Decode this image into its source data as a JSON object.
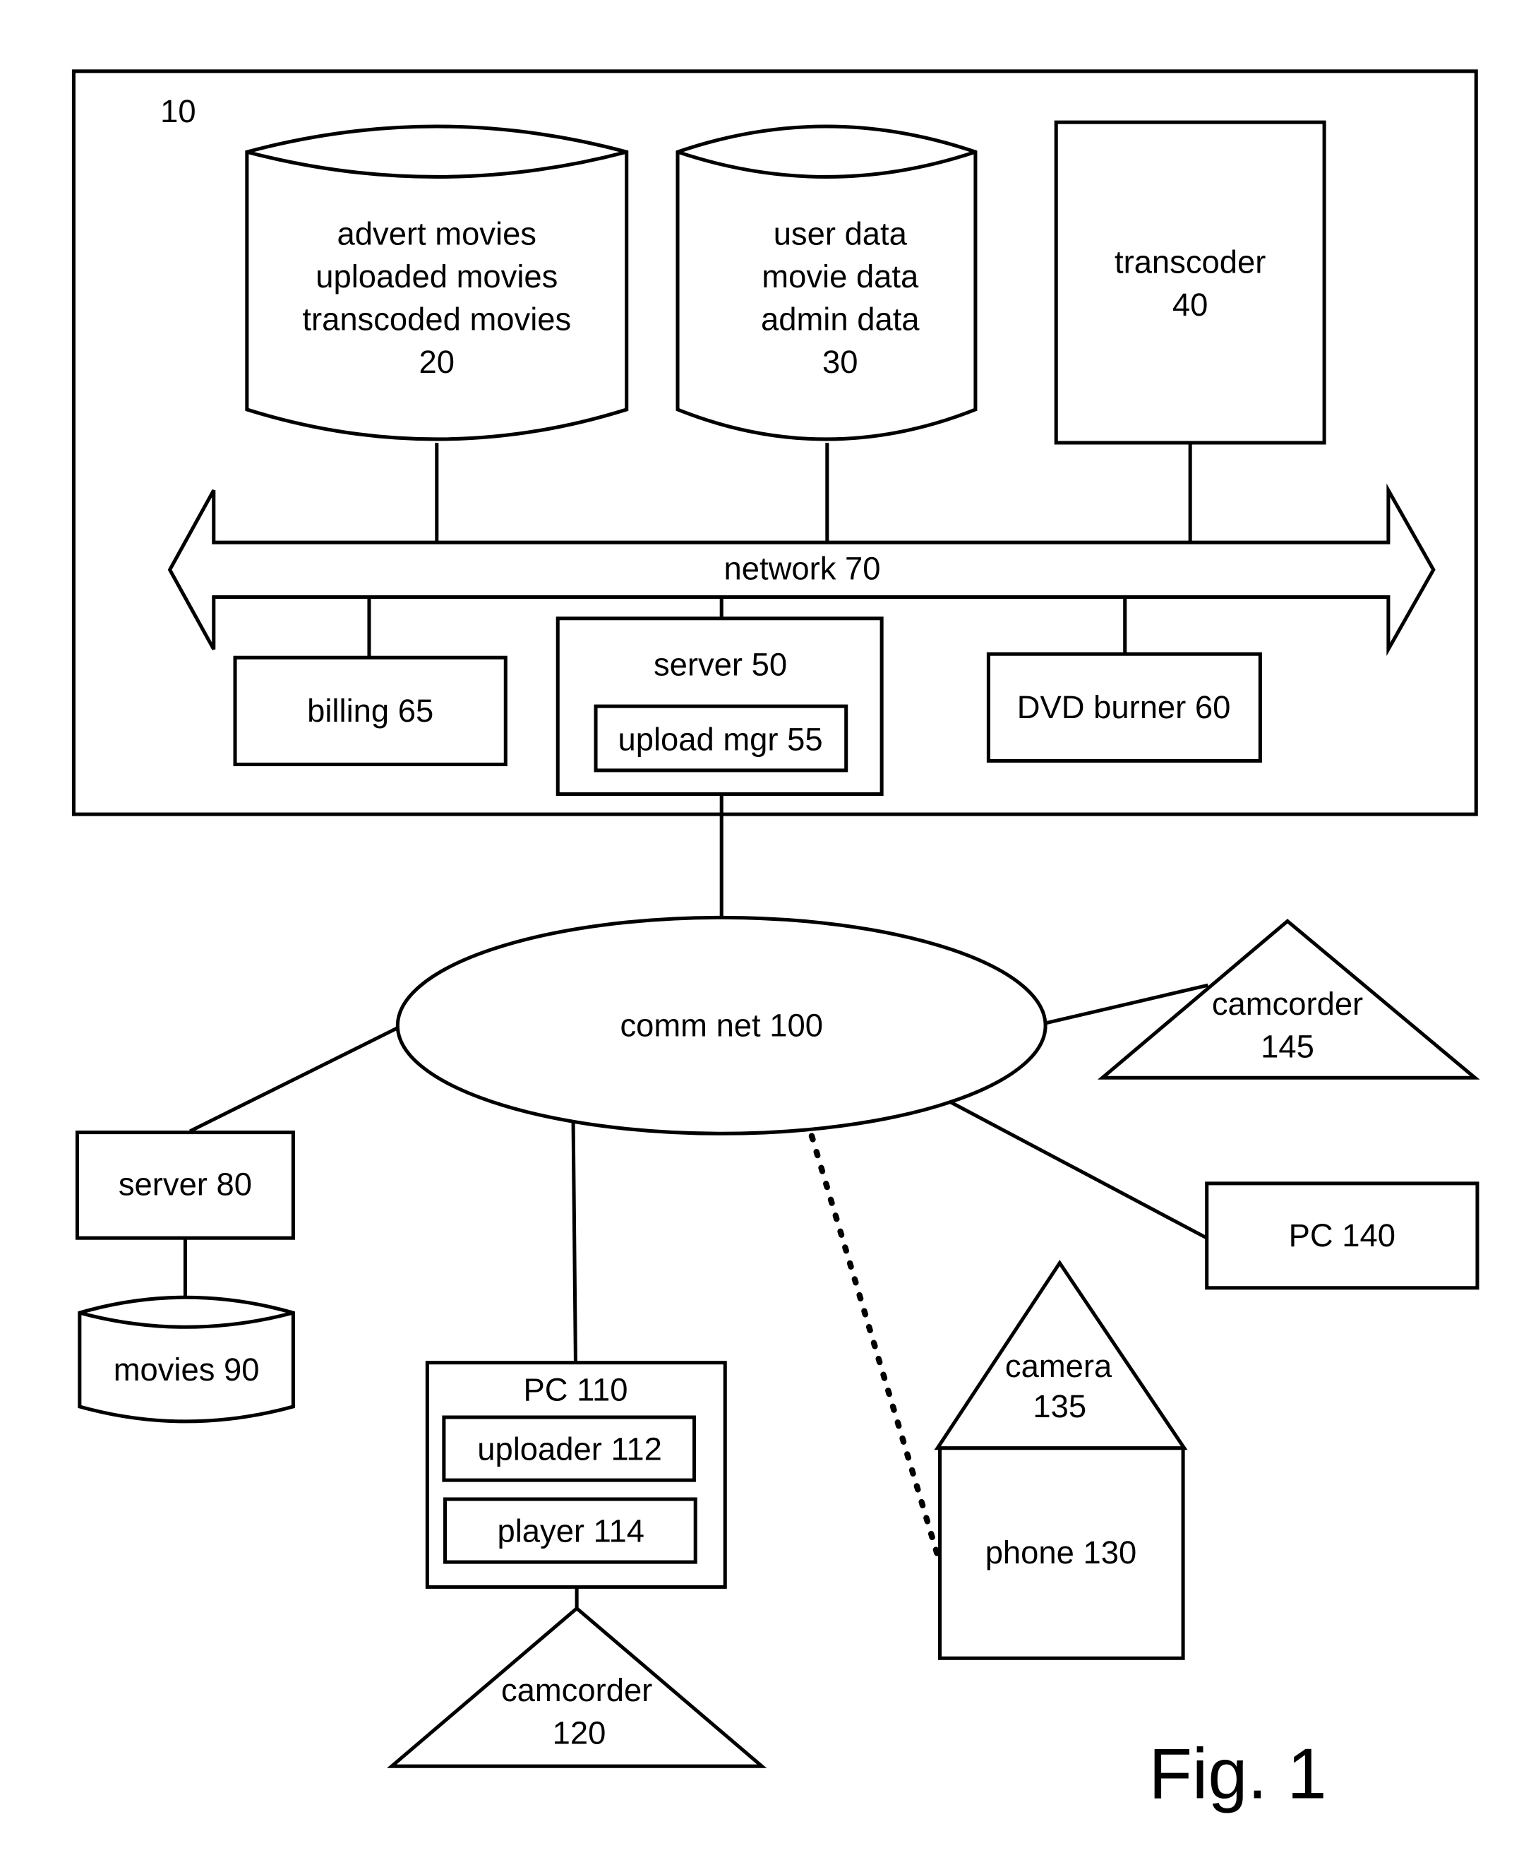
{
  "figure": {
    "label": "Fig. 1",
    "system": {
      "ref": "10",
      "storage_20": {
        "lines": [
          "advert movies",
          "uploaded movies",
          "transcoded movies",
          "20"
        ]
      },
      "storage_30": {
        "lines": [
          "user data",
          "movie data",
          "admin data",
          "30"
        ]
      },
      "transcoder_40": {
        "lines": [
          "transcoder",
          "40"
        ]
      },
      "network_70": "network 70",
      "billing_65": "billing 65",
      "server_50": "server 50",
      "upload_mgr_55": "upload mgr 55",
      "dvd_burner_60": "DVD burner 60"
    },
    "comm_net_100": "comm net 100",
    "server_80": "server 80",
    "movies_90": "movies 90",
    "pc_110": "PC 110",
    "uploader_112": "uploader 112",
    "player_114": "player 114",
    "camcorder_120": {
      "lines": [
        "camcorder",
        "120"
      ]
    },
    "camera_135": {
      "lines": [
        "camera",
        "135"
      ]
    },
    "phone_130": "phone 130",
    "pc_140": "PC 140",
    "camcorder_145": {
      "lines": [
        "camcorder",
        "145"
      ]
    }
  }
}
